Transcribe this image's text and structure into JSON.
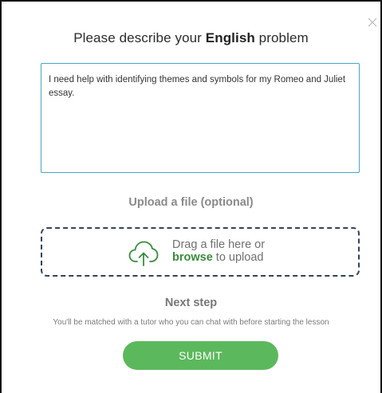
{
  "dialog": {
    "title_prefix": "Please describe your ",
    "subject": "English",
    "title_suffix": " problem",
    "close_icon": "close-icon"
  },
  "problem_input": {
    "value": "I need help with identifying themes and symbols for my Romeo and Juliet essay.",
    "placeholder": ""
  },
  "upload": {
    "heading": "Upload a file (optional)",
    "drag_text": "Drag a file here or",
    "browse_label": "browse",
    "upload_suffix": " to upload",
    "icon": "cloud-upload-icon"
  },
  "next_step": {
    "heading": "Next step",
    "description": "You'll be matched with a tutor who you can chat with before starting the lesson"
  },
  "submit": {
    "label": "SUBMIT"
  },
  "colors": {
    "accent_green": "#5cb85c",
    "link_green": "#3a8b3e",
    "textarea_border": "#4aa3c4",
    "dropzone_border": "#30445a"
  }
}
